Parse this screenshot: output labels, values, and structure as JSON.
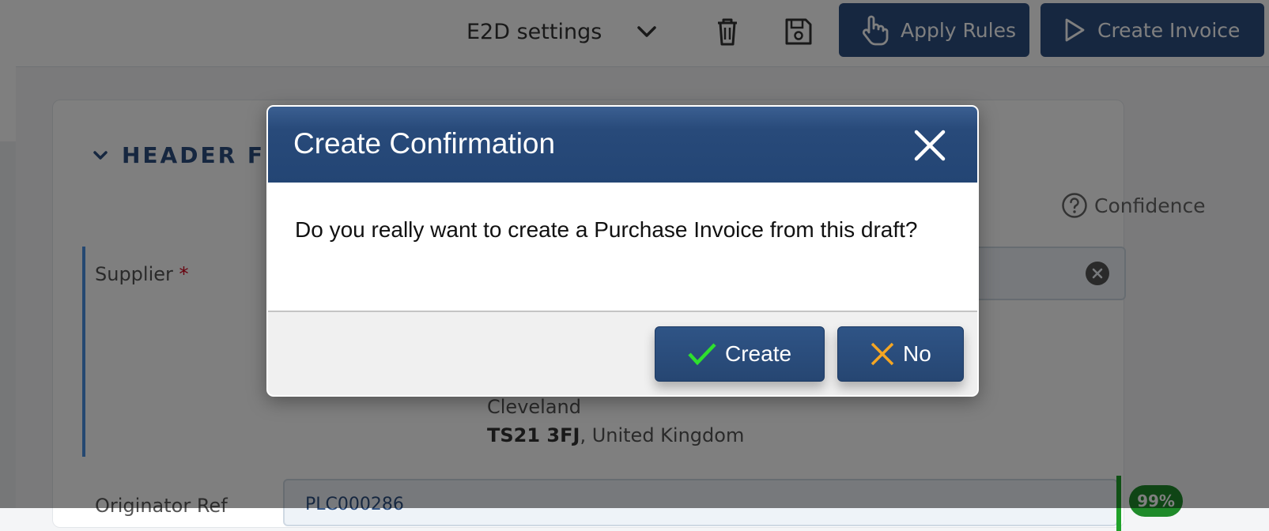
{
  "toolbar": {
    "settings_label": "E2D settings",
    "apply_rules_label": "Apply Rules",
    "create_invoice_label": "Create Invoice"
  },
  "section": {
    "title": "HEADER FIE",
    "confidence_label": "Confidence"
  },
  "fields": {
    "supplier_label": "Supplier",
    "required_marker": "*",
    "address_city": "Cleveland",
    "address_postcode": "TS21 3FJ",
    "address_country": ", United Kingdom",
    "originator_label": "Originator Ref",
    "originator_value": "PLC000286",
    "originator_confidence": "99%"
  },
  "dialog": {
    "title": "Create Confirmation",
    "message": "Do you really want to create a Purchase Invoice from this draft?",
    "confirm_label": "Create",
    "cancel_label": "No"
  },
  "colors": {
    "header_blue": "#284a7a",
    "check_green": "#2ee02e",
    "cross_orange": "#f5a623"
  },
  "icons": [
    "chevron-down-icon",
    "trash-icon",
    "save-icon",
    "hand-pointer-icon",
    "play-icon",
    "help-circle-icon",
    "clear-circle-icon",
    "close-icon",
    "check-icon",
    "cross-icon"
  ]
}
